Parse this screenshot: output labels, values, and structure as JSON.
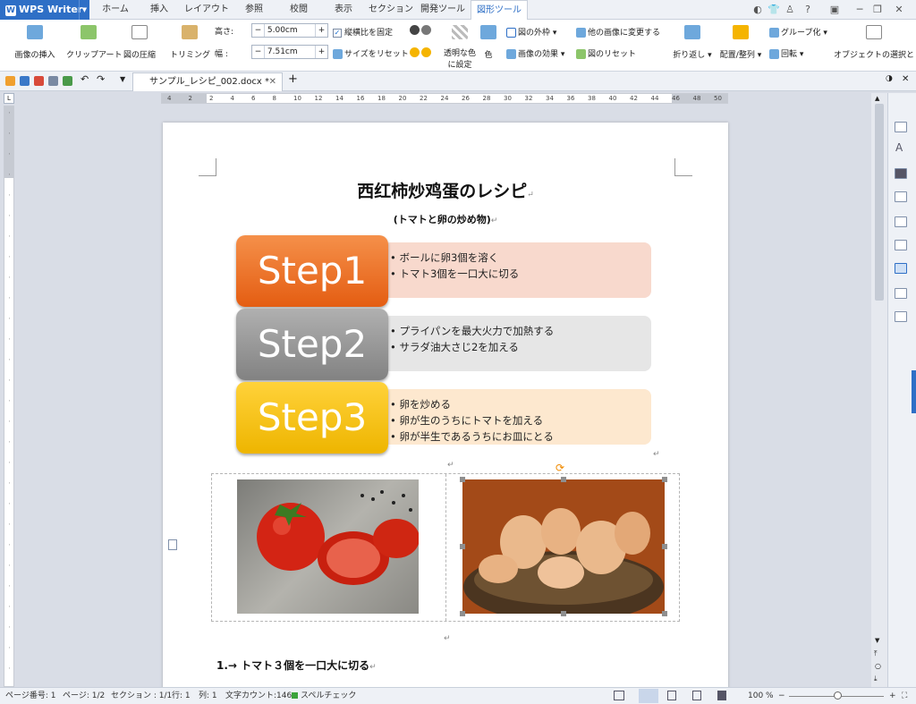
{
  "app": {
    "name": "WPS Writer"
  },
  "tabs": [
    "ホーム",
    "挿入",
    "レイアウト",
    "参照",
    "校閲",
    "表示",
    "セクション",
    "開発ツール",
    "図形ツール"
  ],
  "ribbon": {
    "insert_image": "画像の挿入",
    "clipart": "クリップアート",
    "compress": "図の圧縮",
    "trim": "トリミング",
    "height_label": "高さ:",
    "height_value": "5.00cm",
    "width_label": "幅 :",
    "width_value": "7.51cm",
    "lock_ratio": "縦横比を固定",
    "reset_size": "サイズをリセット",
    "transparent_line1": "透明な色",
    "transparent_line2": "に設定",
    "color": "色",
    "outline": "図の外枠",
    "effects": "画像の効果",
    "change_image": "他の画像に変更する",
    "reset_image": "図のリセット",
    "wrap": "折り返し",
    "arrange": "配置/整列",
    "group": "グループ化",
    "rotate": "回転",
    "selection": "オブジェクトの選択と"
  },
  "document_tab": {
    "name": "サンプル_レシピ_002.docx *"
  },
  "ruler": {
    "h_numbers": [
      "4",
      "2",
      "2",
      "4",
      "6",
      "8",
      "10",
      "12",
      "14",
      "16",
      "18",
      "20",
      "22",
      "24",
      "26",
      "28",
      "30",
      "32",
      "34",
      "36",
      "38",
      "40",
      "42",
      "44",
      "46",
      "48",
      "50"
    ]
  },
  "document": {
    "title": "西红柿炒鸡蛋のレシピ",
    "subtitle": "(トマトと卵の炒め物)",
    "steps": [
      {
        "label": "Step1",
        "items": [
          "• ボールに卵3個を溶く",
          "• トマト3個を一口大に切る"
        ]
      },
      {
        "label": "Step2",
        "items": [
          "• プライパンを最大火力で加熱する",
          "• サラダ油大さじ2を加える"
        ]
      },
      {
        "label": "Step3",
        "items": [
          "• 卵を炒める",
          "• 卵が生のうちにトマトを加える",
          "• 卵が半生であるうちにお皿にとる"
        ]
      }
    ],
    "heading": "1.→ トマト３個を一口大に切る"
  },
  "status": {
    "page_number": "ページ番号: 1",
    "pages": "ページ: 1/2",
    "section": "セクション : 1/1",
    "row": "行: 1",
    "col": "列: 1",
    "word_count": "文字カウント:146",
    "spellcheck": "スペルチェック",
    "zoom": "100 %"
  },
  "colors": {
    "accent": "#2e6fc6",
    "step1": "#f07a2a",
    "step2": "#9a9a9a",
    "step3": "#f5c000"
  }
}
